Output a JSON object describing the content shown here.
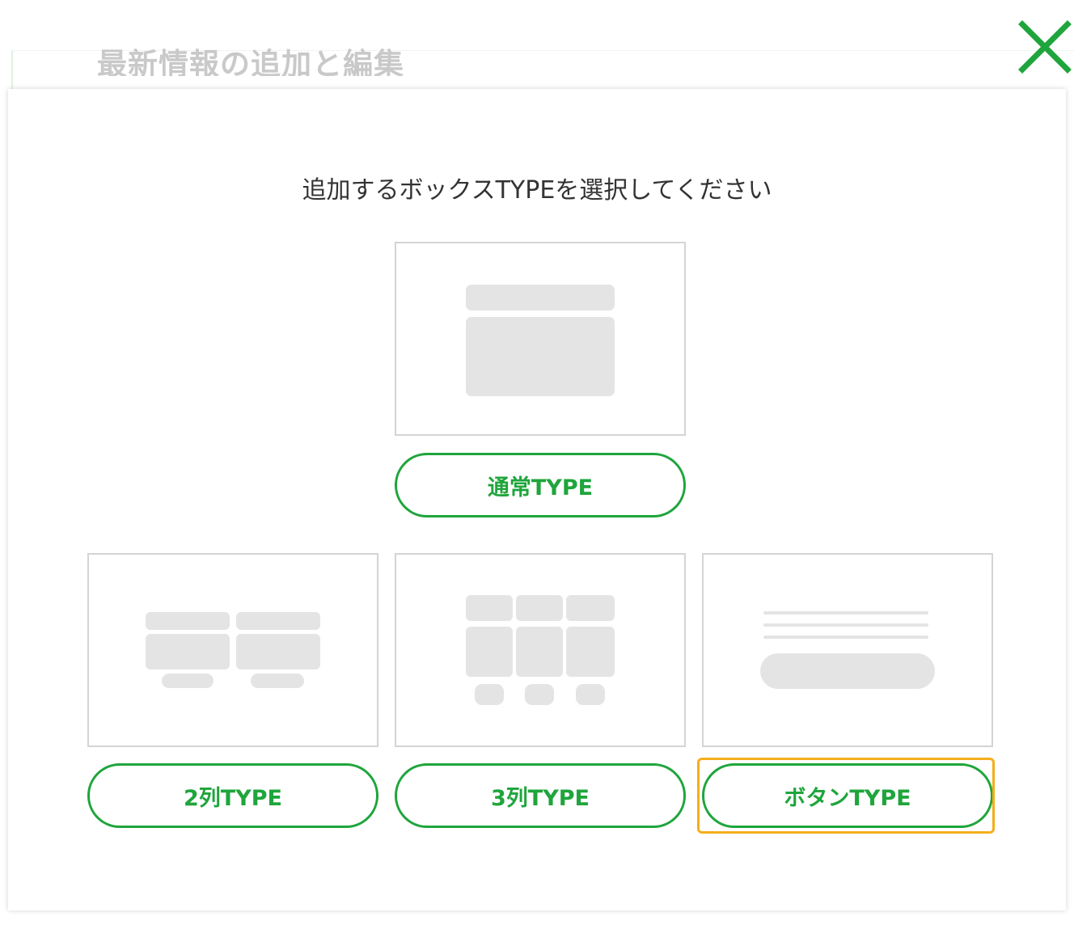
{
  "background": {
    "heading": "最新情報の追加と編集"
  },
  "close": {
    "icon": "close-icon",
    "color": "#1fa53c"
  },
  "modal": {
    "prompt": "追加するボックスTYPEを選択してください",
    "options": [
      {
        "label": "通常TYPE",
        "preview": "normal-layout-preview"
      },
      {
        "label": "2列TYPE",
        "preview": "two-column-layout-preview"
      },
      {
        "label": "3列TYPE",
        "preview": "three-column-layout-preview"
      },
      {
        "label": "ボタンTYPE",
        "preview": "button-layout-preview",
        "focused": true
      }
    ]
  },
  "colors": {
    "accent": "#1fa53c",
    "focus": "#f5ae1b",
    "placeholder": "#e4e4e4",
    "card_border": "#d4d4d4",
    "text": "#333333"
  }
}
